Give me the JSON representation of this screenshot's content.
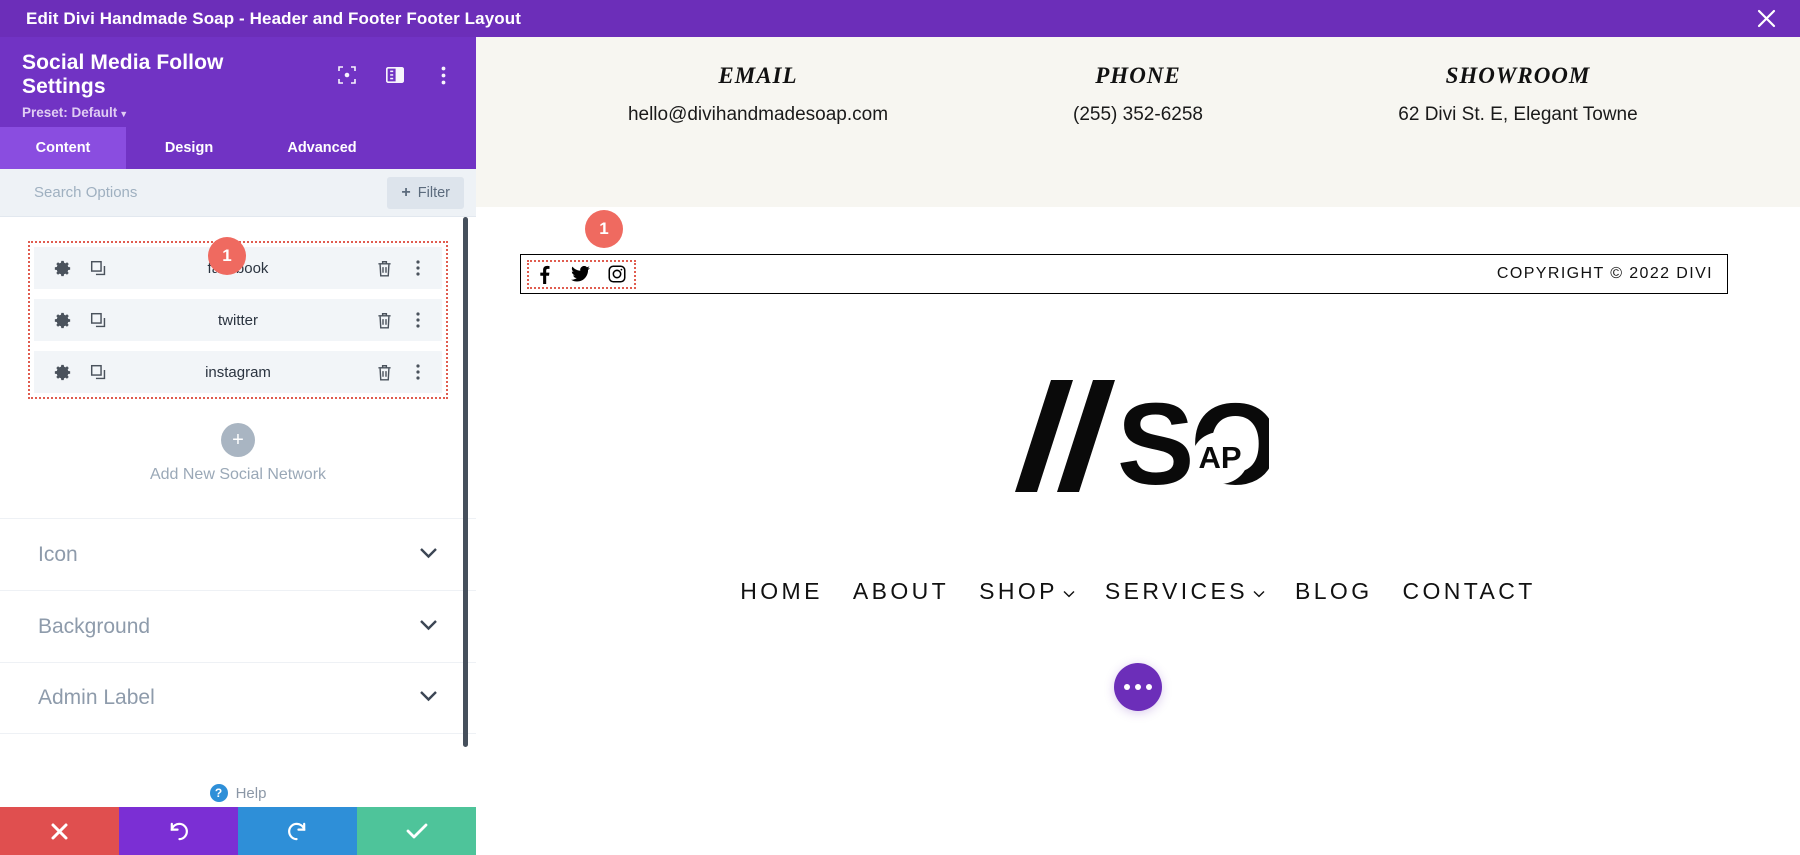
{
  "window": {
    "title": "Edit Divi Handmade Soap - Header and Footer Footer Layout",
    "close_icon": "close-icon"
  },
  "panel": {
    "title": "Social Media Follow Settings",
    "preset_label": "Preset: Default",
    "header_icons": [
      "focus-icon",
      "layout-icon",
      "kebab-menu-icon"
    ],
    "tabs": [
      {
        "label": "Content",
        "active": true
      },
      {
        "label": "Design",
        "active": false
      },
      {
        "label": "Advanced",
        "active": false
      }
    ],
    "search": {
      "placeholder": "Search Options",
      "value": ""
    },
    "filter_button": {
      "label": "Filter",
      "plus": "+"
    },
    "social_networks": [
      {
        "name": "facebook"
      },
      {
        "name": "twitter"
      },
      {
        "name": "instagram"
      }
    ],
    "add_new": {
      "plus": "+",
      "label": "Add New Social Network"
    },
    "toggle_sections": [
      {
        "label": "Icon"
      },
      {
        "label": "Background"
      },
      {
        "label": "Admin Label"
      }
    ],
    "help": {
      "badge": "?",
      "label": "Help"
    },
    "footer_actions": [
      {
        "name": "cancel",
        "icon": "close-icon",
        "color": "#e04f4f"
      },
      {
        "name": "undo",
        "icon": "undo-icon",
        "color": "#7b2fd4"
      },
      {
        "name": "redo",
        "icon": "redo-icon",
        "color": "#2e8fd8"
      },
      {
        "name": "save",
        "icon": "check-icon",
        "color": "#4ec49a"
      }
    ],
    "step_badge": "1"
  },
  "preview": {
    "step_badge": "1",
    "contact": [
      {
        "title": "EMAIL",
        "value": "hello@divihandmadesoap.com"
      },
      {
        "title": "PHONE",
        "value": "(255) 352-6258"
      },
      {
        "title": "SHOWROOM",
        "value": "62 Divi St. E, Elegant Towne"
      }
    ],
    "footer_bar": {
      "social_icons": [
        "facebook-icon",
        "twitter-icon",
        "instagram-icon"
      ],
      "copyright": "COPYRIGHT © 2022 DIVI"
    },
    "logo": {
      "slashes": "//",
      "text": "SO",
      "inner_text": "AP"
    },
    "nav": [
      {
        "label": "HOME",
        "dropdown": false
      },
      {
        "label": "ABOUT",
        "dropdown": false
      },
      {
        "label": "SHOP",
        "dropdown": true
      },
      {
        "label": "SERVICES",
        "dropdown": true
      },
      {
        "label": "BLOG",
        "dropdown": false
      },
      {
        "label": "CONTACT",
        "dropdown": false
      }
    ],
    "fab": {
      "icon": "ellipsis-icon"
    }
  },
  "colors": {
    "brand_purple": "#6c2eb9",
    "panel_purple": "#7133c4",
    "tab_active": "#8a4de0",
    "accent_red": "#e05c4f",
    "badge_red": "#ef6a60",
    "save_green": "#4ec49a",
    "redo_blue": "#2e8fd8"
  }
}
